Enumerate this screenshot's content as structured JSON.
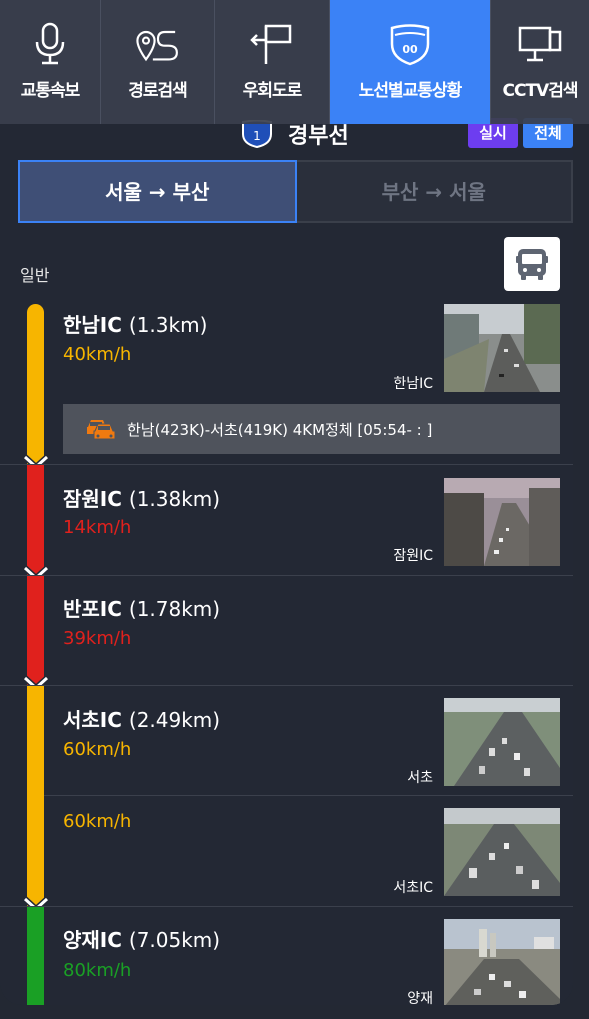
{
  "nav": {
    "tabs": [
      {
        "label": "교통속보",
        "icon": "microphone-icon",
        "active": false
      },
      {
        "label": "경로검색",
        "icon": "route-pin-icon",
        "active": false
      },
      {
        "label": "우회도로",
        "icon": "detour-arrow-icon",
        "active": false
      },
      {
        "label": "노선별교통상황",
        "icon": "highway-shield-icon",
        "active": true
      },
      {
        "label": "CCTV검색",
        "icon": "monitor-icon",
        "active": false
      }
    ]
  },
  "route": {
    "shield_number": "1",
    "name": "경부선",
    "btn_now": "실시",
    "btn_all": "전체"
  },
  "direction": {
    "active": "서울 → 부산",
    "inactive": "부산 → 서울"
  },
  "section": {
    "label": "일반",
    "bus_icon": "bus-icon"
  },
  "colors": {
    "yellow": "#f7b500",
    "red": "#e0211d",
    "green": "#1aa025",
    "accent": "#3b82f6"
  },
  "segments": [
    {
      "name": "한남IC",
      "distance": "(1.3km)",
      "speed": "40km/h",
      "status": "yellow",
      "cctv": "한남IC",
      "alert": "한남(423K)-서초(419K) 4KM정체 [05:54- : ]"
    },
    {
      "name": "잠원IC",
      "distance": "(1.38km)",
      "speed": "14km/h",
      "status": "red",
      "cctv": "잠원IC"
    },
    {
      "name": "반포IC",
      "distance": "(1.78km)",
      "speed": "39km/h",
      "status": "red",
      "cctv": ""
    },
    {
      "name": "서초IC",
      "distance": "(2.49km)",
      "speed": "60km/h",
      "status": "yellow",
      "cctv": "서초"
    },
    {
      "name": "",
      "distance": "",
      "speed": "60km/h",
      "status": "yellow",
      "cctv": "서초IC"
    },
    {
      "name": "양재IC",
      "distance": "(7.05km)",
      "speed": "80km/h",
      "status": "green",
      "cctv": "양재"
    }
  ]
}
